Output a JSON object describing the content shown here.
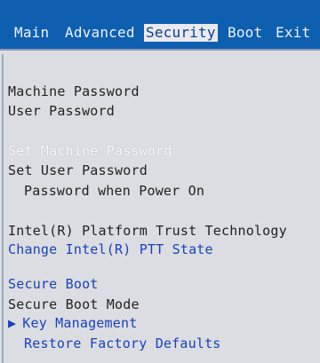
{
  "menu": {
    "tabs": [
      {
        "label": "Main"
      },
      {
        "label": "Advanced"
      },
      {
        "label": "Security",
        "active": true
      },
      {
        "label": "Boot"
      },
      {
        "label": "Exit"
      }
    ]
  },
  "security": {
    "machine_password": "Machine Password",
    "user_password": "User Password",
    "set_machine_password": "Set Machine Password",
    "set_user_password": "Set User Password",
    "password_power_on": "Password when Power On",
    "intel_ptt": "Intel(R) Platform Trust Technology",
    "change_ptt_state": "Change Intel(R) PTT State",
    "secure_boot": "Secure Boot",
    "secure_boot_mode": "Secure Boot Mode",
    "key_management_arrow": "▶",
    "key_management": "Key Management",
    "restore_factory_defaults": "Restore Factory Defaults"
  },
  "colors": {
    "menubar_bg": "#0f5fb0",
    "active_tab_bg": "#e9e9ee",
    "link_blue": "#1a42b8",
    "panel_bg": "#dcdde2"
  }
}
